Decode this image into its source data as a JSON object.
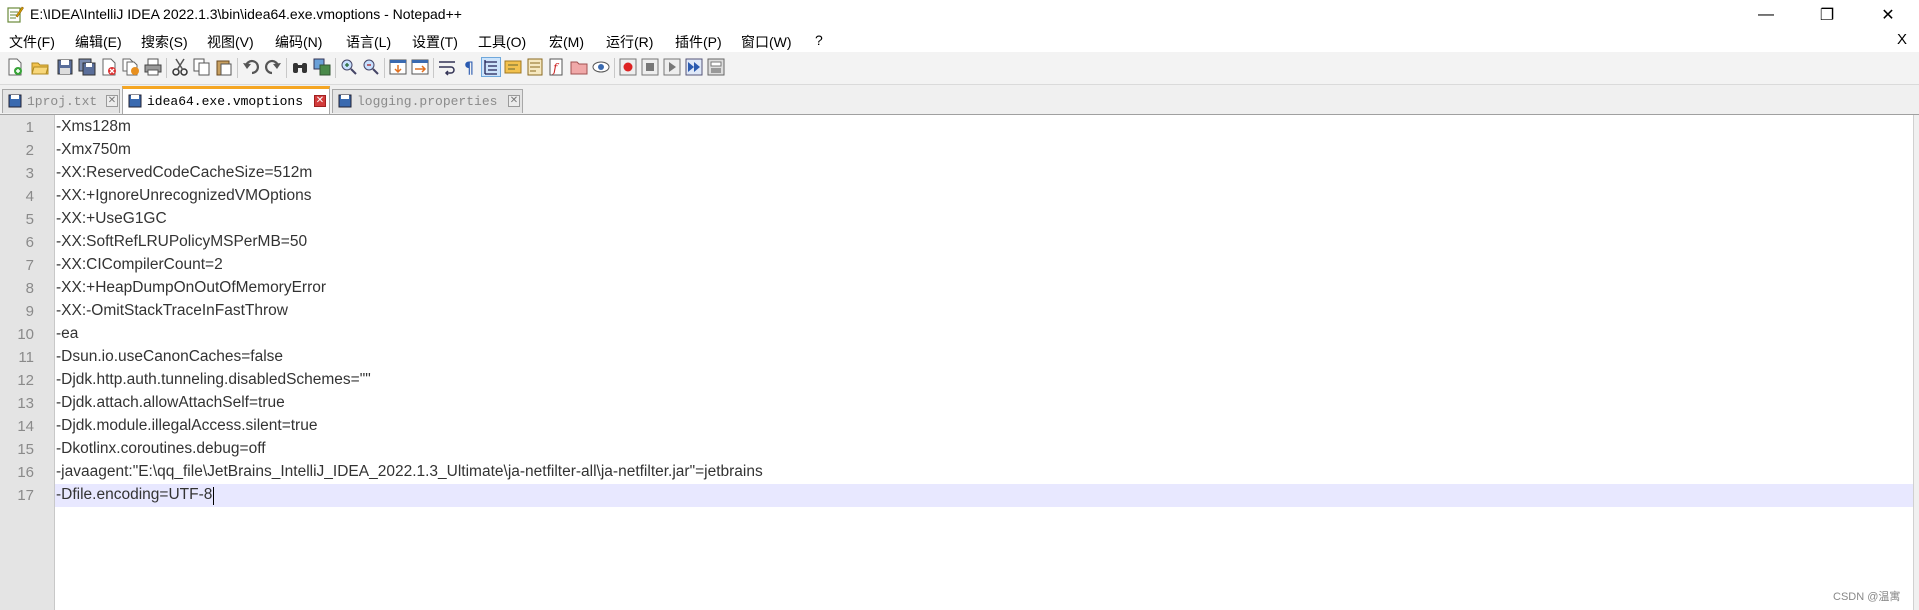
{
  "window": {
    "title": "E:\\IDEA\\IntelliJ IDEA 2022.1.3\\bin\\idea64.exe.vmoptions - Notepad++",
    "min_glyph": "—",
    "max_glyph": "❐",
    "close_glyph": "✕"
  },
  "menu": {
    "items": [
      "文件(F)",
      "编辑(E)",
      "搜索(S)",
      "视图(V)",
      "编码(N)",
      "语言(L)",
      "设置(T)",
      "工具(O)",
      "宏(M)",
      "运行(R)",
      "插件(P)",
      "窗口(W)",
      "?"
    ],
    "close_glyph": "X"
  },
  "toolbar": {
    "icons": [
      "new-file-icon",
      "open-file-icon",
      "save-icon",
      "save-all-icon",
      "close-icon",
      "close-all-icon",
      "print-icon",
      "cut-icon",
      "copy-icon",
      "paste-icon",
      "undo-icon",
      "redo-icon",
      "find-icon",
      "replace-icon",
      "zoom-in-icon",
      "zoom-out-icon",
      "sync-vertical-icon",
      "sync-horizontal-icon",
      "word-wrap-icon",
      "show-all-chars-icon",
      "indent-guide-icon",
      "language-icon",
      "doc-map-icon",
      "function-list-icon",
      "folder-workspace-icon",
      "monitoring-icon",
      "record-macro-icon",
      "stop-macro-icon",
      "play-macro-icon",
      "run-macro-multiple-icon",
      "save-macro-icon"
    ]
  },
  "tabs": [
    {
      "label": "1proj.txt",
      "active": false
    },
    {
      "label": "idea64.exe.vmoptions",
      "active": true
    },
    {
      "label": "logging.properties",
      "active": false
    }
  ],
  "editor": {
    "lines": [
      "-Xms128m",
      "-Xmx750m",
      "-XX:ReservedCodeCacheSize=512m",
      "-XX:+IgnoreUnrecognizedVMOptions",
      "-XX:+UseG1GC",
      "-XX:SoftRefLRUPolicyMSPerMB=50",
      "-XX:CICompilerCount=2",
      "-XX:+HeapDumpOnOutOfMemoryError",
      "-XX:-OmitStackTraceInFastThrow",
      "-ea",
      "-Dsun.io.useCanonCaches=false",
      "-Djdk.http.auth.tunneling.disabledSchemes=\"\"",
      "-Djdk.attach.allowAttachSelf=true",
      "-Djdk.module.illegalAccess.silent=true",
      "-Dkotlinx.coroutines.debug=off",
      "-javaagent:\"E:\\qq_file\\JetBrains_IntelliJ_IDEA_2022.1.3_Ultimate\\ja-netfilter-all\\ja-netfilter.jar\"=jetbrains",
      "-Dfile.encoding=UTF-8"
    ],
    "current_line": 17
  },
  "watermark": "CSDN @温寓"
}
